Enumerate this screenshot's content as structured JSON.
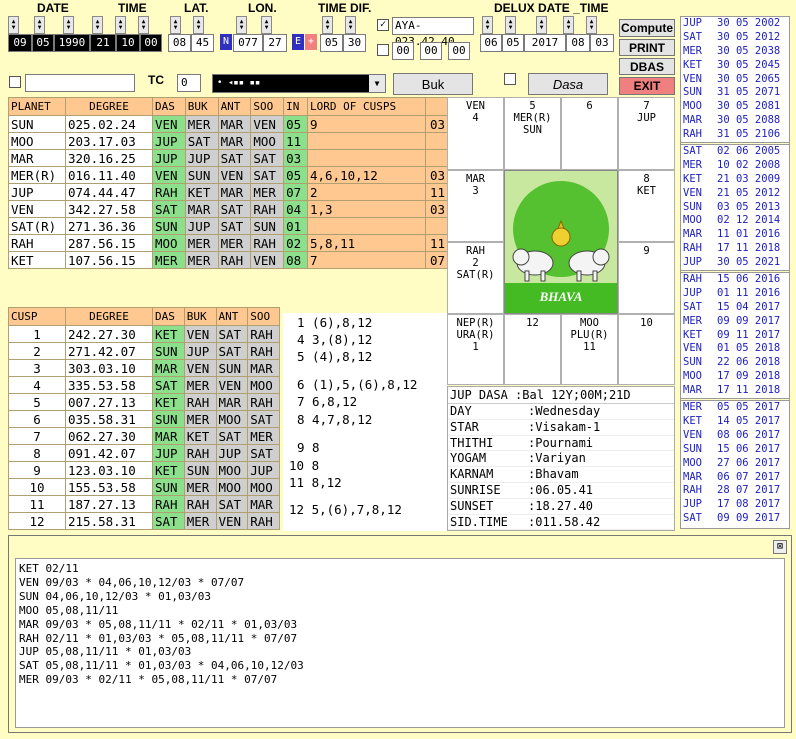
{
  "header": {
    "date_label": "DATE",
    "time_label": "TIME",
    "lat_label": "LAT.",
    "lon_label": "LON.",
    "timedif_label": "TIME DIF.",
    "delux_label": "DELUX DATE _TIME"
  },
  "inputs": {
    "day": "09",
    "month": "05",
    "year": "1990",
    "hour": "21",
    "minute": "10",
    "second": "00",
    "lat_deg": "08",
    "lat_min": "45",
    "lat_dir": "N",
    "lon_deg": "077",
    "lon_min": "27",
    "lon_dir": "E",
    "lon_sign": "+",
    "td_h": "05",
    "td_m": "30",
    "ayanamsa": "AYA-023.42.40",
    "ext1": "00",
    "ext2": "00",
    "ext3": "00",
    "dx_d": "06",
    "dx_m": "05",
    "dx_y": "2017",
    "dx_h": "08",
    "dx_min": "03",
    "tc_label": "TC",
    "tc_value": "0",
    "name_value": "",
    "combo_value": "•  ◂▪▪  ▪▪"
  },
  "buttons": {
    "compute": "Compute",
    "print": "PRINT",
    "dbas": "DBAS",
    "exit": "EXIT",
    "buk": "Buk",
    "dasa": "Dasa"
  },
  "planet_table": {
    "headers": [
      "PLANET",
      "DEGREE",
      "DAS",
      "BUK",
      "ANT",
      "SOO",
      "IN",
      "LORD OF CUSPS"
    ],
    "rows": [
      [
        "SUN",
        "025.02.24",
        "VEN",
        "MER",
        "MAR",
        "VEN",
        "05",
        "9",
        "03"
      ],
      [
        "MOO",
        "203.17.03",
        "JUP",
        "SAT",
        "MAR",
        "MOO",
        "11",
        "",
        ""
      ],
      [
        "MAR",
        "320.16.25",
        "JUP",
        "JUP",
        "SAT",
        "SAT",
        "03",
        "",
        ""
      ],
      [
        "MER(R)",
        "016.11.40",
        "VEN",
        "SUN",
        "VEN",
        "SAT",
        "05",
        "4,6,10,12",
        "03"
      ],
      [
        "JUP",
        "074.44.47",
        "RAH",
        "KET",
        "MAR",
        "MER",
        "07",
        "2",
        "11"
      ],
      [
        "VEN",
        "342.27.58",
        "SAT",
        "MAR",
        "SAT",
        "RAH",
        "04",
        "1,3",
        "03"
      ],
      [
        "SAT(R)",
        "271.36.36",
        "SUN",
        "JUP",
        "SAT",
        "SUN",
        "01",
        "",
        ""
      ],
      [
        "RAH",
        "287.56.15",
        "MOO",
        "MER",
        "MER",
        "RAH",
        "02",
        "5,8,11",
        "11"
      ],
      [
        "KET",
        "107.56.15",
        "MER",
        "MER",
        "RAH",
        "VEN",
        "08",
        "7",
        "07"
      ]
    ]
  },
  "cusp_table": {
    "headers": [
      "CUSP",
      "DEGREE",
      "DAS",
      "BUK",
      "ANT",
      "SOO"
    ],
    "rows": [
      [
        "1",
        "242.27.30",
        "KET",
        "VEN",
        "SAT",
        "RAH"
      ],
      [
        "2",
        "271.42.07",
        "SUN",
        "JUP",
        "SAT",
        "RAH"
      ],
      [
        "3",
        "303.03.10",
        "MAR",
        "VEN",
        "SUN",
        "MAR"
      ],
      [
        "4",
        "335.53.58",
        "SAT",
        "MER",
        "VEN",
        "MOO"
      ],
      [
        "5",
        "007.27.13",
        "KET",
        "RAH",
        "MAR",
        "RAH"
      ],
      [
        "6",
        "035.58.31",
        "SUN",
        "MER",
        "MOO",
        "SAT"
      ],
      [
        "7",
        "062.27.30",
        "MAR",
        "KET",
        "SAT",
        "MER"
      ],
      [
        "8",
        "091.42.07",
        "JUP",
        "RAH",
        "JUP",
        "SAT"
      ],
      [
        "9",
        "123.03.10",
        "KET",
        "SUN",
        "MOO",
        "JUP"
      ],
      [
        "10",
        "155.53.58",
        "SUN",
        "MER",
        "MOO",
        "MOO"
      ],
      [
        "11",
        "187.27.13",
        "RAH",
        "RAH",
        "SAT",
        "MAR"
      ],
      [
        "12",
        "215.58.31",
        "SAT",
        "MER",
        "VEN",
        "RAH"
      ]
    ]
  },
  "cusp_sigs": [
    "1 (6),8,12",
    "4 3,(8),12",
    "5 (4),8,12",
    "6 (1),5,(6),8,12",
    "7 6,8,12",
    "8 4,7,8,12",
    "9 8",
    "10 8",
    "11 8,12",
    "12 5,(6),7,8,12"
  ],
  "chart": {
    "c1": "VEN\n4",
    "c2": "5\nMER(R)\nSUN",
    "c3": "6",
    "c4": "7\nJUP",
    "c5": "MAR\n3",
    "c6": "8\nKET",
    "c7": "RAH\n2\nSAT(R)",
    "c8": "9",
    "c9": "NEP(R)\nURA(R)\n1",
    "c10": "12",
    "c11": "MOO\nPLU(R)\n11",
    "c12": "10",
    "center": "BHAVA"
  },
  "info": {
    "dasa_bal": "JUP DASA :Bal 12Y;00M;21D",
    "rows": [
      [
        "DAY",
        ":Wednesday"
      ],
      [
        "STAR",
        ":Visakam-1"
      ],
      [
        "THITHI",
        ":Pournami"
      ],
      [
        "YOGAM",
        ":Variyan"
      ],
      [
        "KARNAM",
        ":Bhavam"
      ],
      [
        "SUNRISE",
        ":06.05.41"
      ],
      [
        "SUNSET",
        ":18.27.40"
      ],
      [
        "SID.TIME",
        ":011.58.42"
      ]
    ]
  },
  "dasa_list": [
    [
      "JUP",
      "30 05 2002"
    ],
    [
      "SAT",
      "30 05 2012"
    ],
    [
      "MER",
      "30 05 2038"
    ],
    [
      "KET",
      "30 05 2045"
    ],
    [
      "VEN",
      "30 05 2065"
    ],
    [
      "SUN",
      "31 05 2071"
    ],
    [
      "MOO",
      "30 05 2081"
    ],
    [
      "MAR",
      "30 05 2088"
    ],
    [
      "RAH",
      "31 05 2106"
    ],
    [
      "SAT",
      "02 06 2005"
    ],
    [
      "MER",
      "10 02 2008"
    ],
    [
      "KET",
      "21 03 2009"
    ],
    [
      "VEN",
      "21 05 2012"
    ],
    [
      "SUN",
      "03 05 2013"
    ],
    [
      "MOO",
      "02 12 2014"
    ],
    [
      "MAR",
      "11 01 2016"
    ],
    [
      "RAH",
      "17 11 2018"
    ],
    [
      "JUP",
      "30 05 2021"
    ],
    [
      "RAH",
      "15 06 2016"
    ],
    [
      "JUP",
      "01 11 2016"
    ],
    [
      "SAT",
      "15 04 2017"
    ],
    [
      "MER",
      "09 09 2017"
    ],
    [
      "KET",
      "09 11 2017"
    ],
    [
      "VEN",
      "01 05 2018"
    ],
    [
      "SUN",
      "22 06 2018"
    ],
    [
      "MOO",
      "17 09 2018"
    ],
    [
      "MAR",
      "17 11 2018"
    ],
    [
      "MER",
      "05 05 2017"
    ],
    [
      "KET",
      "14 05 2017"
    ],
    [
      "VEN",
      "08 06 2017"
    ],
    [
      "SUN",
      "15 06 2017"
    ],
    [
      "MOO",
      "27 06 2017"
    ],
    [
      "MAR",
      "06 07 2017"
    ],
    [
      "RAH",
      "28 07 2017"
    ],
    [
      "JUP",
      "17 08 2017"
    ],
    [
      "SAT",
      "09 09 2017"
    ]
  ],
  "report": [
    "KET 02/11",
    "VEN 09/03 * 04,06,10,12/03 * 07/07",
    "SUN 04,06,10,12/03 * 01,03/03",
    "MOO 05,08,11/11",
    "MAR 09/03 * 05,08,11/11 * 02/11 * 01,03/03",
    "RAH 02/11 * 01,03/03 * 05,08,11/11 * 07/07",
    "JUP 05,08,11/11 * 01,03/03",
    "SAT 05,08,11/11 * 01,03/03 * 04,06,10,12/03",
    "MER 09/03 * 02/11 * 05,08,11/11 * 07/07"
  ],
  "colors": {
    "orange": "#ffc891",
    "green": "#8ce08c",
    "gray": "#cfcfcf",
    "bg": "#fffdc4",
    "exit": "#f08080",
    "blue": "#2020c0",
    "center_green": "#44bb22"
  }
}
